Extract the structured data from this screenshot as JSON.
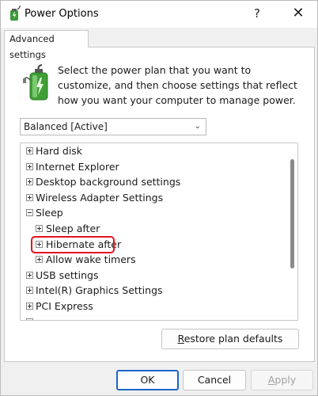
{
  "window": {
    "title": "Power Options",
    "help_glyph": "?",
    "close_glyph": "✕"
  },
  "tab": {
    "label": "Advanced settings"
  },
  "description": "Select the power plan that you want to customize, and then choose settings that reflect how you want your computer to manage power.",
  "plan_select": {
    "value": "Balanced [Active]"
  },
  "tree": {
    "items": [
      {
        "label": "Hard disk",
        "state": "collapsed"
      },
      {
        "label": "Internet Explorer",
        "state": "collapsed"
      },
      {
        "label": "Desktop background settings",
        "state": "collapsed"
      },
      {
        "label": "Wireless Adapter Settings",
        "state": "collapsed"
      },
      {
        "label": "Sleep",
        "state": "expanded"
      },
      {
        "label": "Sleep after",
        "state": "collapsed"
      },
      {
        "label": "Hibernate after",
        "state": "collapsed",
        "highlighted": true
      },
      {
        "label": "Allow wake timers",
        "state": "collapsed"
      },
      {
        "label": "USB settings",
        "state": "collapsed"
      },
      {
        "label": "Intel(R) Graphics Settings",
        "state": "collapsed"
      },
      {
        "label": "PCI Express",
        "state": "collapsed"
      }
    ],
    "highlight_color": "#e3141c"
  },
  "buttons": {
    "restore_prefix": "R",
    "restore_rest": "estore plan defaults",
    "ok": "OK",
    "cancel": "Cancel",
    "apply_prefix": "A",
    "apply_rest": "pply"
  },
  "colors": {
    "accent": "#1b66c9"
  }
}
